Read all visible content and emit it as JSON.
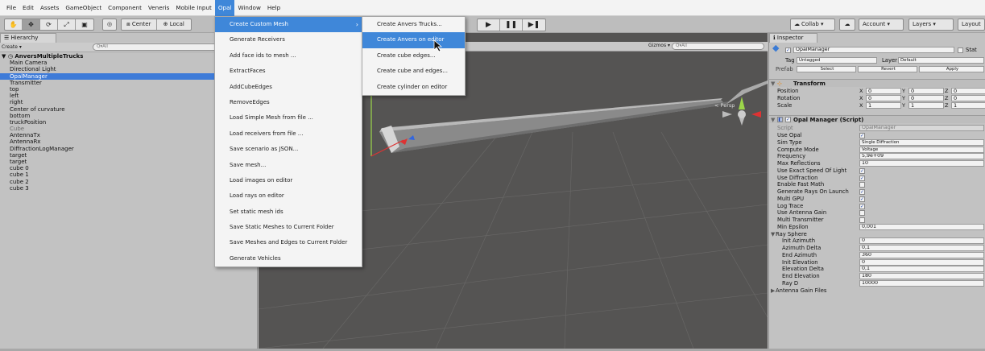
{
  "menubar": {
    "items": [
      "File",
      "Edit",
      "Assets",
      "GameObject",
      "Component",
      "Veneris",
      "Mobile Input",
      "Opal",
      "Window",
      "Help"
    ],
    "active_index": 7
  },
  "toolbar": {
    "center_label": "Center",
    "local_label": "Local",
    "collab_label": "Collab ▾",
    "account_label": "Account ▾",
    "layers_label": "Layers ▾",
    "layout_label": "Layout"
  },
  "hierarchy": {
    "tab_label": "Hierarchy",
    "create_label": "Create ▾",
    "search_placeholder": "Q▾All",
    "scene_name": "AnversMultipleTrucks",
    "items": [
      {
        "label": "Main Camera",
        "state": "normal"
      },
      {
        "label": "Directional Light",
        "state": "normal"
      },
      {
        "label": "OpalManager",
        "state": "selected"
      },
      {
        "label": "Transmitter",
        "state": "normal"
      },
      {
        "label": "top",
        "state": "normal"
      },
      {
        "label": "left",
        "state": "normal"
      },
      {
        "label": "right",
        "state": "normal"
      },
      {
        "label": "Center of curvature",
        "state": "normal"
      },
      {
        "label": "bottom",
        "state": "normal"
      },
      {
        "label": "truckPosition",
        "state": "normal"
      },
      {
        "label": "Cube",
        "state": "dim"
      },
      {
        "label": "AntennaTx",
        "state": "normal"
      },
      {
        "label": "AntennaRx",
        "state": "normal"
      },
      {
        "label": "DiffractionLogManager",
        "state": "normal"
      },
      {
        "label": "target",
        "state": "normal"
      },
      {
        "label": "target",
        "state": "normal"
      },
      {
        "label": "cube 0",
        "state": "normal"
      },
      {
        "label": "cube 1",
        "state": "normal"
      },
      {
        "label": "cube 2",
        "state": "normal"
      },
      {
        "label": "cube 3",
        "state": "normal"
      }
    ]
  },
  "scene": {
    "gizmos_label": "Gizmos ▾",
    "search_placeholder": "Q▾All",
    "persp_label": "< Persp"
  },
  "opal_menu": {
    "items": [
      {
        "label": "Create Custom Mesh",
        "submenu": true,
        "highlighted": true
      },
      {
        "label": "Generate Receivers"
      },
      {
        "label": "Add face ids to mesh ..."
      },
      {
        "label": "ExtractFaces"
      },
      {
        "label": "AddCubeEdges"
      },
      {
        "label": "RemoveEdges"
      },
      {
        "label": "Load Simple Mesh from file ..."
      },
      {
        "label": "Load receivers from file ..."
      },
      {
        "label": "Save scenario as JSON..."
      },
      {
        "label": "Save mesh..."
      },
      {
        "label": "Load images on editor"
      },
      {
        "label": "Load rays on editor"
      },
      {
        "label": "Set static mesh ids"
      },
      {
        "label": "Save Static Meshes to Current Folder"
      },
      {
        "label": "Save Meshes and Edges to Current Folder"
      },
      {
        "label": "Generate Vehicles"
      }
    ]
  },
  "custom_mesh_submenu": {
    "items": [
      {
        "label": "Create Anvers Trucks..."
      },
      {
        "label": "Create Anvers on editor",
        "highlighted": true
      },
      {
        "label": "Create cube edges..."
      },
      {
        "label": "Create cube and edges..."
      },
      {
        "label": "Create cylinder on editor"
      }
    ]
  },
  "inspector": {
    "tab_label": "Inspector",
    "object_name": "OpalManager",
    "static_label": "Stat",
    "tag_label": "Tag",
    "tag_value": "Untagged",
    "layer_label": "Layer",
    "layer_value": "Default",
    "prefab_label": "Prefab",
    "prefab_select": "Select",
    "prefab_revert": "Revert",
    "prefab_apply": "Apply",
    "transform": {
      "title": "Transform",
      "rows": [
        {
          "label": "Position",
          "x": "0",
          "y": "0",
          "z": "0"
        },
        {
          "label": "Rotation",
          "x": "0",
          "y": "0",
          "z": "0"
        },
        {
          "label": "Scale",
          "x": "1",
          "y": "1",
          "z": "1"
        }
      ]
    },
    "script": {
      "title": "Opal Manager (Script)",
      "script_label": "Script",
      "script_value": "OpalManager",
      "fields": [
        {
          "label": "Use Opal",
          "type": "check",
          "checked": true
        },
        {
          "label": "Sim Type",
          "type": "dropdown",
          "value": "Single Diffraction"
        },
        {
          "label": "Compute Mode",
          "type": "dropdown",
          "value": "Voltage"
        },
        {
          "label": "Frequency",
          "type": "text",
          "value": "5,9e+09"
        },
        {
          "label": "Max Reflections",
          "type": "text",
          "value": "10"
        },
        {
          "label": "Use Exact Speed Of Light",
          "type": "check",
          "checked": true
        },
        {
          "label": "Use Diffraction",
          "type": "check",
          "checked": true
        },
        {
          "label": "Enable Fast Math",
          "type": "check",
          "checked": false
        },
        {
          "label": "Generate Rays On Launch",
          "type": "check",
          "checked": true
        },
        {
          "label": "Multi GPU",
          "type": "check",
          "checked": true
        },
        {
          "label": "Log Trace",
          "type": "check",
          "checked": true
        },
        {
          "label": "Use Antenna Gain",
          "type": "check",
          "checked": false
        },
        {
          "label": "Multi Transmitter",
          "type": "check",
          "checked": false
        },
        {
          "label": "Min Epsilon",
          "type": "text",
          "value": "0,001"
        }
      ],
      "ray_sphere_label": "Ray Sphere",
      "ray_sphere": [
        {
          "label": "Init Azimuth",
          "value": "0"
        },
        {
          "label": "Azimuth Delta",
          "value": "0,1"
        },
        {
          "label": "End Azimuth",
          "value": "360"
        },
        {
          "label": "Init Elevation",
          "value": "0"
        },
        {
          "label": "Elevation Delta",
          "value": "0,1"
        },
        {
          "label": "End Elevation",
          "value": "180"
        },
        {
          "label": "Ray D",
          "value": "10000"
        }
      ],
      "antenna_gain_files_label": "Antenna Gain Files"
    }
  }
}
